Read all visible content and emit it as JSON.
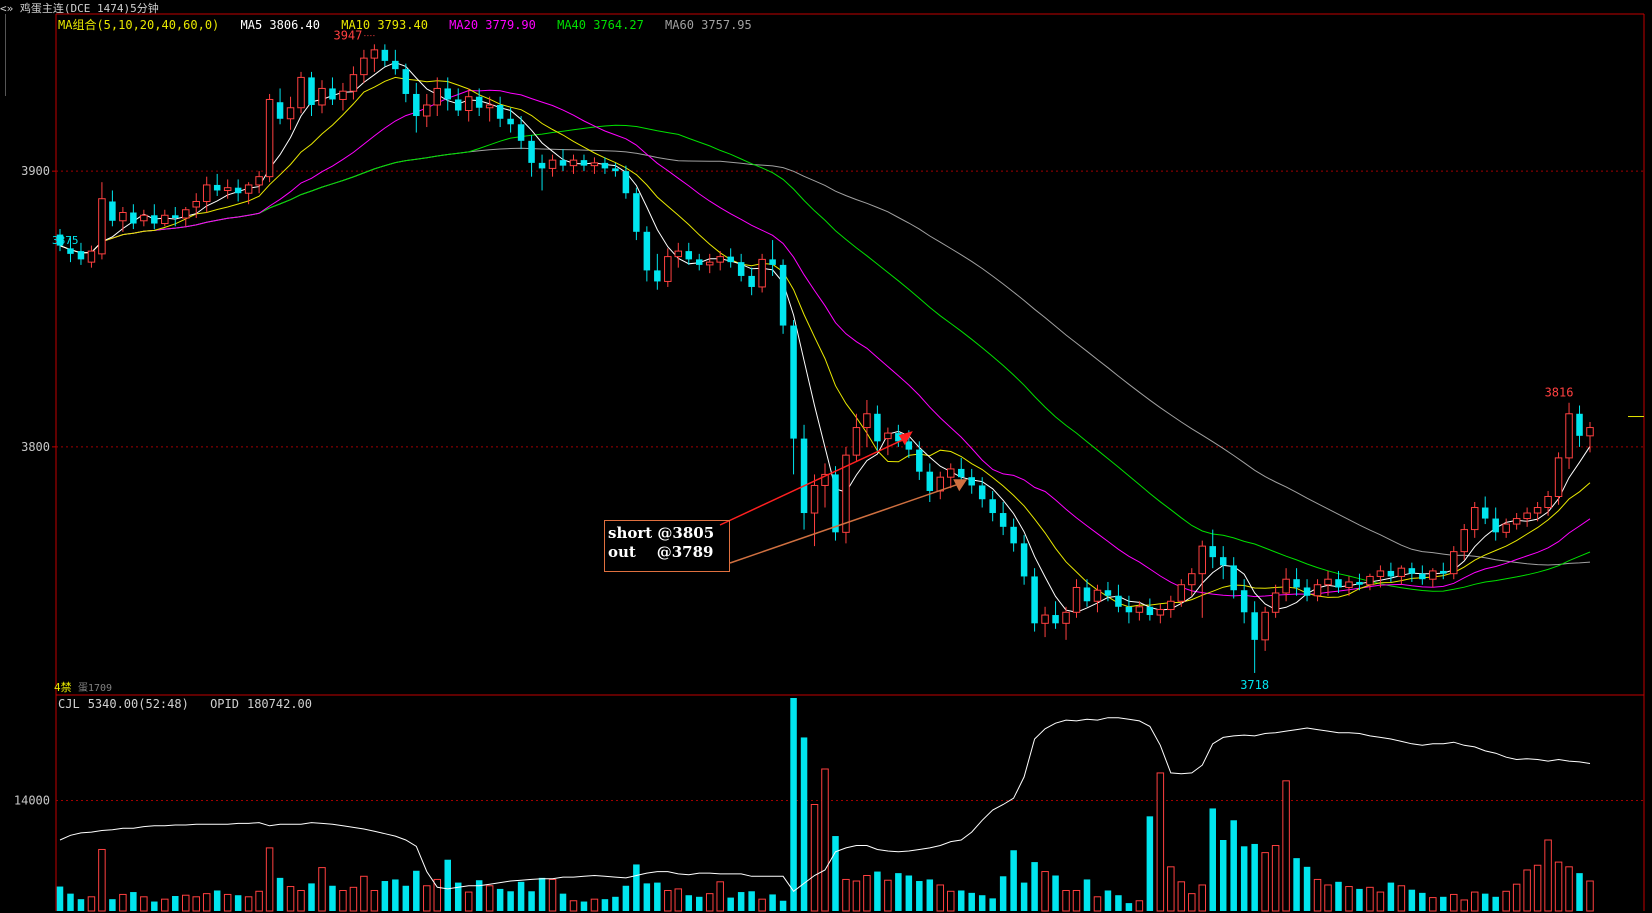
{
  "window": {
    "title_prefix": "<»",
    "title": "鸡蛋主连(DCE 1474)5分钟"
  },
  "legend": {
    "group": "MA组合(5,10,20,40,60,0)",
    "ma5": "MA5 3806.40",
    "ma10": "MA10 3793.40",
    "ma20": "MA20 3779.90",
    "ma40": "MA40 3764.27",
    "ma60": "MA60 3757.95"
  },
  "volume_legend": {
    "cjl": "CJL",
    "cjl_value": "5340.00(52:48)",
    "opid": "OPID",
    "opid_value": "180742.00"
  },
  "annotation": {
    "line1": "short @3805",
    "line2": "out    @3789"
  },
  "labels": {
    "high": "3947",
    "low": "3718",
    "recent_high": "3816",
    "left_price": "3875",
    "bottom_tag": "4禁",
    "bottom_contract": "蛋1709"
  },
  "colors": {
    "background": "#000000",
    "up": "#ff4040",
    "down": "#00e5ee",
    "ma5": "#ffffff",
    "ma10": "#e8e800",
    "ma20": "#ff00ff",
    "ma40": "#00e000",
    "ma60": "#a0a0a0",
    "grid": "#a00000",
    "annotation_border": "#e0703f",
    "arrow_short": "#ff2020",
    "arrow_out": "#d07040"
  },
  "chart_data": [
    {
      "type": "candlestick",
      "y_ticks": [
        3900,
        3800
      ],
      "ylim": [
        3710,
        3957
      ],
      "grid": "dashed horizontal at tick levels",
      "ohlc": [
        [
          3877,
          3879,
          3871,
          3873
        ],
        [
          3872,
          3876,
          3867,
          3870
        ],
        [
          3871,
          3874,
          3866,
          3868
        ],
        [
          3867,
          3873,
          3865,
          3871
        ],
        [
          3870,
          3896,
          3868,
          3890
        ],
        [
          3889,
          3893,
          3880,
          3882
        ],
        [
          3882,
          3887,
          3878,
          3885
        ],
        [
          3885,
          3888,
          3879,
          3881
        ],
        [
          3882,
          3886,
          3880,
          3884
        ],
        [
          3884,
          3888,
          3879,
          3881
        ],
        [
          3881,
          3886,
          3880,
          3884
        ],
        [
          3884,
          3887,
          3880,
          3883
        ],
        [
          3883,
          3887,
          3880,
          3886
        ],
        [
          3887,
          3892,
          3883,
          3889
        ],
        [
          3889,
          3898,
          3885,
          3895
        ],
        [
          3895,
          3899,
          3891,
          3893
        ],
        [
          3893,
          3897,
          3890,
          3894
        ],
        [
          3894,
          3897,
          3889,
          3892
        ],
        [
          3892,
          3896,
          3888,
          3895
        ],
        [
          3895,
          3900,
          3892,
          3898
        ],
        [
          3898,
          3928,
          3896,
          3926
        ],
        [
          3925,
          3930,
          3917,
          3919
        ],
        [
          3919,
          3927,
          3915,
          3923
        ],
        [
          3923,
          3936,
          3921,
          3934
        ],
        [
          3934,
          3936,
          3920,
          3924
        ],
        [
          3924,
          3933,
          3921,
          3930
        ],
        [
          3930,
          3934,
          3924,
          3926
        ],
        [
          3926,
          3932,
          3922,
          3929
        ],
        [
          3929,
          3938,
          3926,
          3935
        ],
        [
          3935,
          3944,
          3932,
          3941
        ],
        [
          3941,
          3946,
          3936,
          3944
        ],
        [
          3944,
          3946,
          3938,
          3940
        ],
        [
          3940,
          3944,
          3935,
          3937
        ],
        [
          3937,
          3939,
          3925,
          3928
        ],
        [
          3928,
          3932,
          3914,
          3920
        ],
        [
          3920,
          3928,
          3916,
          3924
        ],
        [
          3924,
          3934,
          3920,
          3930
        ],
        [
          3930,
          3934,
          3922,
          3926
        ],
        [
          3926,
          3930,
          3920,
          3922
        ],
        [
          3922,
          3930,
          3918,
          3927
        ],
        [
          3927,
          3930,
          3920,
          3923
        ],
        [
          3923,
          3927,
          3918,
          3924
        ],
        [
          3924,
          3927,
          3916,
          3919
        ],
        [
          3919,
          3923,
          3914,
          3917
        ],
        [
          3917,
          3920,
          3908,
          3911
        ],
        [
          3911,
          3913,
          3898,
          3903
        ],
        [
          3903,
          3906,
          3893,
          3901
        ],
        [
          3901,
          3906,
          3898,
          3904
        ],
        [
          3904,
          3908,
          3900,
          3902
        ],
        [
          3902,
          3906,
          3899,
          3904
        ],
        [
          3904,
          3906,
          3900,
          3902
        ],
        [
          3902,
          3905,
          3899,
          3903
        ],
        [
          3903,
          3905,
          3899,
          3901
        ],
        [
          3901,
          3903,
          3898,
          3900
        ],
        [
          3900,
          3902,
          3890,
          3892
        ],
        [
          3892,
          3894,
          3875,
          3878
        ],
        [
          3878,
          3880,
          3860,
          3864
        ],
        [
          3864,
          3870,
          3857,
          3860
        ],
        [
          3860,
          3872,
          3858,
          3869
        ],
        [
          3869,
          3874,
          3865,
          3871
        ],
        [
          3871,
          3874,
          3866,
          3868
        ],
        [
          3868,
          3870,
          3864,
          3866
        ],
        [
          3866,
          3870,
          3863,
          3867
        ],
        [
          3867,
          3871,
          3864,
          3869
        ],
        [
          3869,
          3872,
          3865,
          3867
        ],
        [
          3867,
          3870,
          3860,
          3862
        ],
        [
          3862,
          3865,
          3855,
          3858
        ],
        [
          3858,
          3870,
          3856,
          3868
        ],
        [
          3868,
          3875,
          3862,
          3866
        ],
        [
          3866,
          3868,
          3841,
          3844
        ],
        [
          3844,
          3846,
          3790,
          3803
        ],
        [
          3803,
          3808,
          3770,
          3776
        ],
        [
          3776,
          3790,
          3764,
          3786
        ],
        [
          3786,
          3794,
          3778,
          3790
        ],
        [
          3790,
          3793,
          3766,
          3769
        ],
        [
          3769,
          3800,
          3765,
          3797
        ],
        [
          3797,
          3812,
          3795,
          3807
        ],
        [
          3807,
          3817,
          3800,
          3812
        ],
        [
          3812,
          3815,
          3798,
          3802
        ],
        [
          3803,
          3807,
          3797,
          3805
        ],
        [
          3805,
          3808,
          3800,
          3802
        ],
        [
          3802,
          3806,
          3796,
          3799
        ],
        [
          3799,
          3802,
          3788,
          3791
        ],
        [
          3791,
          3794,
          3780,
          3784
        ],
        [
          3784,
          3791,
          3781,
          3789
        ],
        [
          3789,
          3794,
          3785,
          3792
        ],
        [
          3792,
          3796,
          3786,
          3789
        ],
        [
          3789,
          3792,
          3783,
          3786
        ],
        [
          3786,
          3789,
          3778,
          3781
        ],
        [
          3781,
          3784,
          3773,
          3776
        ],
        [
          3776,
          3780,
          3768,
          3771
        ],
        [
          3771,
          3774,
          3762,
          3765
        ],
        [
          3765,
          3768,
          3750,
          3753
        ],
        [
          3753,
          3756,
          3733,
          3736
        ],
        [
          3736,
          3742,
          3731,
          3739
        ],
        [
          3739,
          3744,
          3734,
          3736
        ],
        [
          3736,
          3742,
          3730,
          3740
        ],
        [
          3740,
          3752,
          3738,
          3749
        ],
        [
          3749,
          3752,
          3742,
          3744
        ],
        [
          3744,
          3750,
          3740,
          3748
        ],
        [
          3748,
          3751,
          3744,
          3746
        ],
        [
          3746,
          3750,
          3740,
          3742
        ],
        [
          3742,
          3746,
          3736,
          3740
        ],
        [
          3740,
          3744,
          3737,
          3742
        ],
        [
          3742,
          3745,
          3737,
          3739
        ],
        [
          3739,
          3743,
          3736,
          3741
        ],
        [
          3741,
          3746,
          3738,
          3744
        ],
        [
          3744,
          3752,
          3742,
          3750
        ],
        [
          3750,
          3756,
          3746,
          3754
        ],
        [
          3754,
          3766,
          3738,
          3764
        ],
        [
          3764,
          3770,
          3756,
          3760
        ],
        [
          3760,
          3764,
          3752,
          3757
        ],
        [
          3757,
          3760,
          3745,
          3748
        ],
        [
          3748,
          3752,
          3736,
          3740
        ],
        [
          3740,
          3744,
          3718,
          3730
        ],
        [
          3730,
          3742,
          3726,
          3740
        ],
        [
          3740,
          3750,
          3738,
          3747
        ],
        [
          3747,
          3756,
          3744,
          3752
        ],
        [
          3752,
          3756,
          3746,
          3749
        ],
        [
          3749,
          3752,
          3744,
          3746
        ],
        [
          3746,
          3752,
          3744,
          3750
        ],
        [
          3750,
          3755,
          3746,
          3752
        ],
        [
          3752,
          3755,
          3747,
          3749
        ],
        [
          3749,
          3753,
          3746,
          3751
        ],
        [
          3751,
          3754,
          3748,
          3750
        ],
        [
          3750,
          3754,
          3748,
          3753
        ],
        [
          3753,
          3757,
          3749,
          3755
        ],
        [
          3755,
          3758,
          3751,
          3753
        ],
        [
          3753,
          3757,
          3750,
          3756
        ],
        [
          3756,
          3758,
          3751,
          3754
        ],
        [
          3754,
          3757,
          3750,
          3752
        ],
        [
          3752,
          3756,
          3749,
          3755
        ],
        [
          3755,
          3758,
          3752,
          3754
        ],
        [
          3754,
          3764,
          3752,
          3762
        ],
        [
          3762,
          3772,
          3759,
          3770
        ],
        [
          3770,
          3780,
          3767,
          3778
        ],
        [
          3778,
          3782,
          3772,
          3774
        ],
        [
          3774,
          3778,
          3766,
          3769
        ],
        [
          3769,
          3774,
          3767,
          3772
        ],
        [
          3772,
          3776,
          3770,
          3774
        ],
        [
          3774,
          3778,
          3771,
          3776
        ],
        [
          3776,
          3780,
          3773,
          3778
        ],
        [
          3778,
          3784,
          3775,
          3782
        ],
        [
          3782,
          3798,
          3779,
          3796
        ],
        [
          3796,
          3816,
          3792,
          3812
        ],
        [
          3812,
          3815,
          3800,
          3804
        ],
        [
          3804,
          3809,
          3798,
          3807
        ]
      ],
      "annotations": {
        "max": 3947,
        "min": 3718,
        "recent_high": 3816,
        "left_label": 3875
      }
    },
    {
      "type": "bar",
      "title": "CJL",
      "y_ticks": [
        14000
      ],
      "ylim": [
        0,
        27000
      ],
      "series": [
        {
          "name": "CJL",
          "values": [
            3100,
            2200,
            1500,
            1800,
            7800,
            1500,
            2100,
            2400,
            1800,
            1200,
            1500,
            1900,
            2000,
            1800,
            2200,
            2600,
            2100,
            2000,
            1800,
            2500,
            8000,
            4200,
            3100,
            2600,
            3500,
            5500,
            3200,
            2600,
            3000,
            4400,
            2600,
            3800,
            4000,
            3200,
            5100,
            3200,
            4000,
            6500,
            3600,
            2400,
            3900,
            3200,
            2800,
            2500,
            3700,
            2500,
            4200,
            4000,
            2200,
            1300,
            1200,
            1500,
            1500,
            1800,
            3200,
            5900,
            3500,
            3600,
            2600,
            2800,
            2000,
            1800,
            2200,
            3700,
            1700,
            2400,
            2500,
            1500,
            2100,
            1300,
            27000,
            22000,
            13500,
            18000,
            9500,
            4000,
            3800,
            4500,
            5000,
            3900,
            4800,
            4500,
            3800,
            4000,
            3300,
            2500,
            2600,
            2300,
            2000,
            1600,
            4400,
            7700,
            3600,
            6200,
            5000,
            4500,
            2600,
            2600,
            4000,
            1800,
            2600,
            2000,
            1000,
            1300,
            12000,
            17500,
            5600,
            3700,
            2200,
            3300,
            13000,
            9000,
            11500,
            8200,
            8500,
            7400,
            8300,
            16500,
            6700,
            5600,
            4000,
            3300,
            3700,
            3100,
            2800,
            3000,
            2400,
            3600,
            3200,
            2700,
            2300,
            1700,
            1800,
            2100,
            1400,
            2400,
            2200,
            1800,
            2500,
            3400,
            5200,
            5800,
            9000,
            6200,
            5600,
            4800,
            3800,
            5200,
            15000,
            4800,
            5900,
            5400,
            5900,
            5500
          ]
        },
        {
          "name": "OPID",
          "values": [
            179000,
            179600,
            179900,
            180000,
            180200,
            180300,
            180500,
            180500,
            180700,
            180800,
            180800,
            180900,
            180900,
            181000,
            181000,
            181000,
            181000,
            181100,
            181100,
            181200,
            180800,
            181000,
            181000,
            181000,
            181200,
            181100,
            181000,
            180800,
            180600,
            180400,
            180100,
            179800,
            179500,
            179000,
            178200,
            175000,
            173000,
            172800,
            173000,
            173200,
            173200,
            173400,
            173600,
            173800,
            173900,
            174000,
            174100,
            174100,
            174300,
            174300,
            174400,
            174500,
            174400,
            174300,
            174200,
            174500,
            174800,
            175000,
            175000,
            174700,
            174600,
            174800,
            174800,
            174700,
            174700,
            174700,
            174400,
            174400,
            174400,
            174400,
            172500,
            173500,
            174500,
            175200,
            177500,
            178000,
            178300,
            178300,
            177800,
            177600,
            177500,
            177600,
            177800,
            178000,
            178300,
            178800,
            179000,
            180000,
            181500,
            182800,
            183500,
            184300,
            187000,
            191800,
            193100,
            193800,
            194200,
            194100,
            194300,
            194200,
            194500,
            194500,
            194300,
            194100,
            193400,
            191000,
            187500,
            187400,
            187500,
            188500,
            191200,
            192000,
            192200,
            192300,
            192200,
            192500,
            192600,
            192800,
            193000,
            193200,
            193000,
            192800,
            192600,
            192600,
            192500,
            192200,
            192000,
            191800,
            191500,
            191200,
            191000,
            191200,
            191200,
            191400,
            191000,
            190800,
            190300,
            190000,
            189500,
            189200,
            189300,
            189200,
            189000,
            189200,
            189000,
            188900,
            188700,
            188200,
            187200,
            184000,
            182500,
            180800
          ]
        }
      ],
      "opid_ylim": [
        170000,
        197000
      ]
    }
  ]
}
